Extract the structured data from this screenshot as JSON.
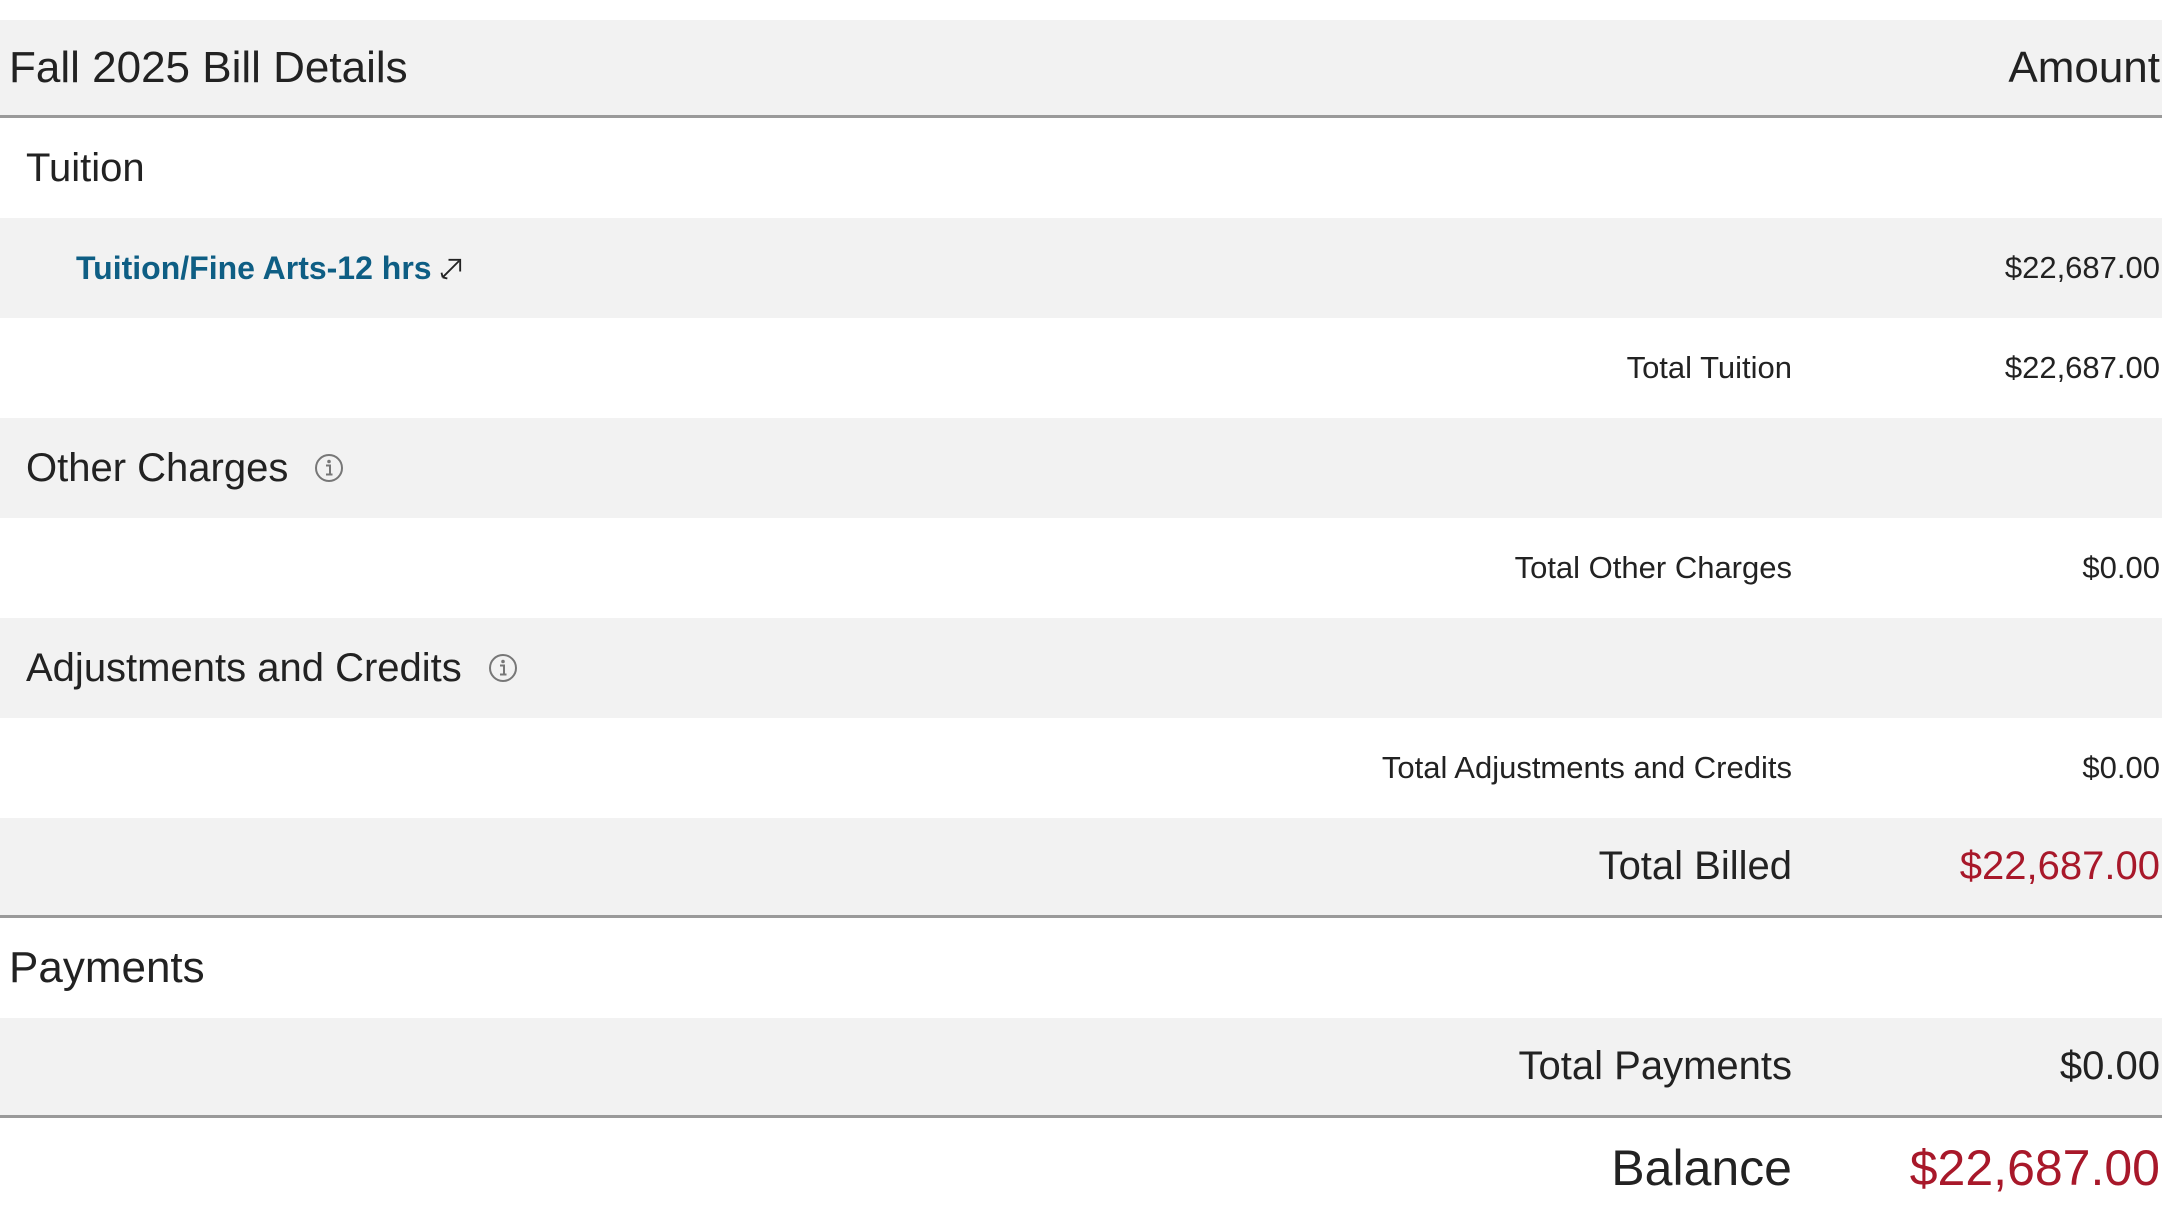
{
  "header": {
    "title": "Fall 2025 Bill Details",
    "amount_label": "Amount"
  },
  "tuition": {
    "section_title": "Tuition",
    "items": [
      {
        "label": "Tuition/Fine Arts-12 hrs",
        "amount": "$22,687.00"
      }
    ],
    "total_label": "Total Tuition",
    "total_amount": "$22,687.00"
  },
  "other_charges": {
    "section_title": "Other Charges",
    "total_label": "Total Other Charges",
    "total_amount": "$0.00"
  },
  "adjustments": {
    "section_title": "Adjustments and Credits",
    "total_label": "Total Adjustments and Credits",
    "total_amount": "$0.00"
  },
  "total_billed": {
    "label": "Total Billed",
    "amount": "$22,687.00"
  },
  "payments": {
    "section_title": "Payments",
    "total_label": "Total Payments",
    "total_amount": "$0.00"
  },
  "balance": {
    "label": "Balance",
    "amount": "$22,687.00"
  },
  "colors": {
    "link": "#0e5e84",
    "red_total": "#a8182a",
    "shaded_row": "#f2f2f2",
    "divider": "#9a9a9a"
  },
  "icons": {
    "info": "info-circle-icon",
    "external": "external-link-icon"
  }
}
